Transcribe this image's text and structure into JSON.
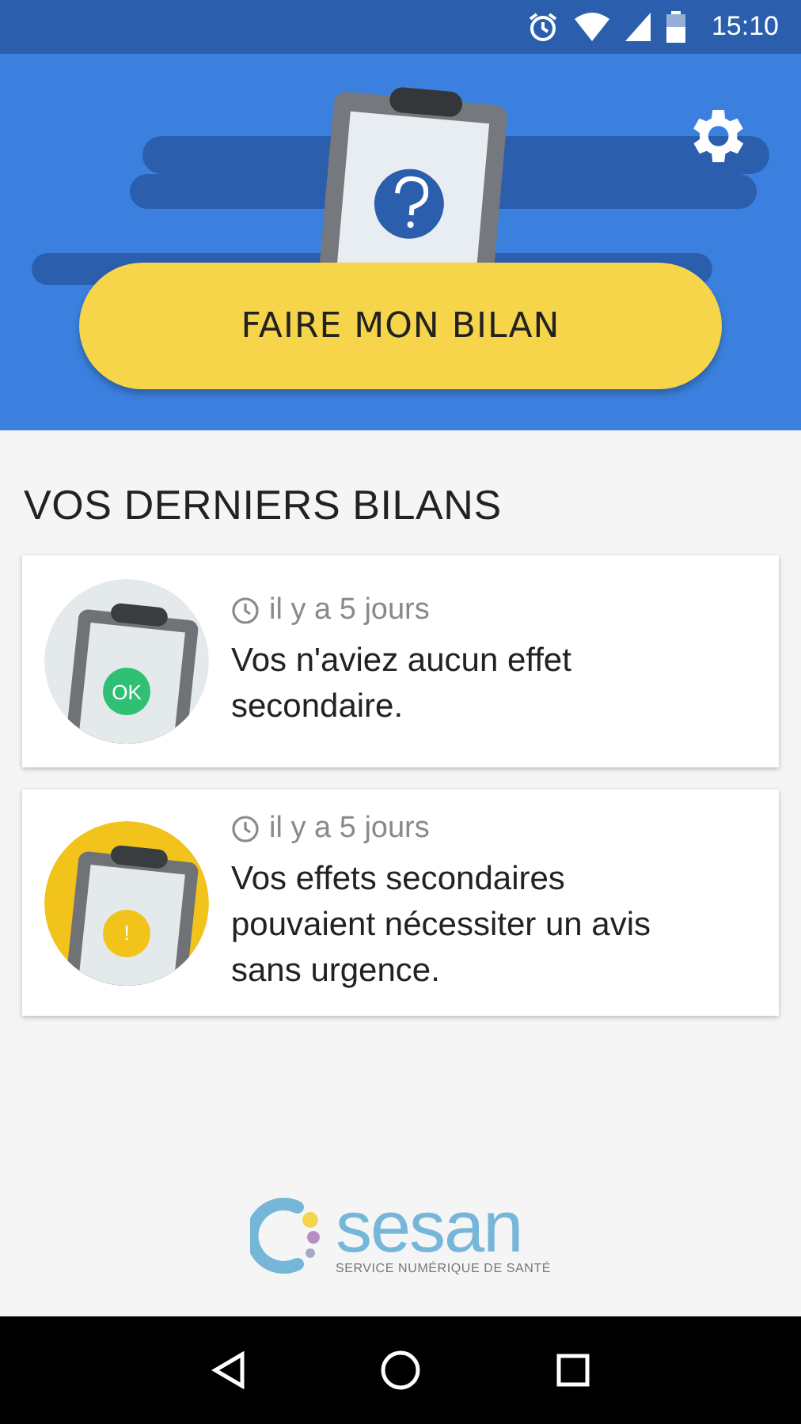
{
  "status_bar": {
    "time": "15:10"
  },
  "header": {
    "button": "FAIRE MON BILAN"
  },
  "section_title": "VOS DERNIERS BILANS",
  "reports": [
    {
      "kind": "ok",
      "badge": "OK",
      "time": "il y a 5 jours",
      "message": "Vos n'aviez aucun effet secondaire."
    },
    {
      "kind": "warning",
      "badge": "!",
      "time": "il y a 5 jours",
      "message": "Vos effets secondaires pouvaient nécessiter un avis sans urgence."
    }
  ],
  "logo": {
    "name": "sesan",
    "tagline": "SERVICE NUMÉRIQUE DE SANTÉ"
  }
}
